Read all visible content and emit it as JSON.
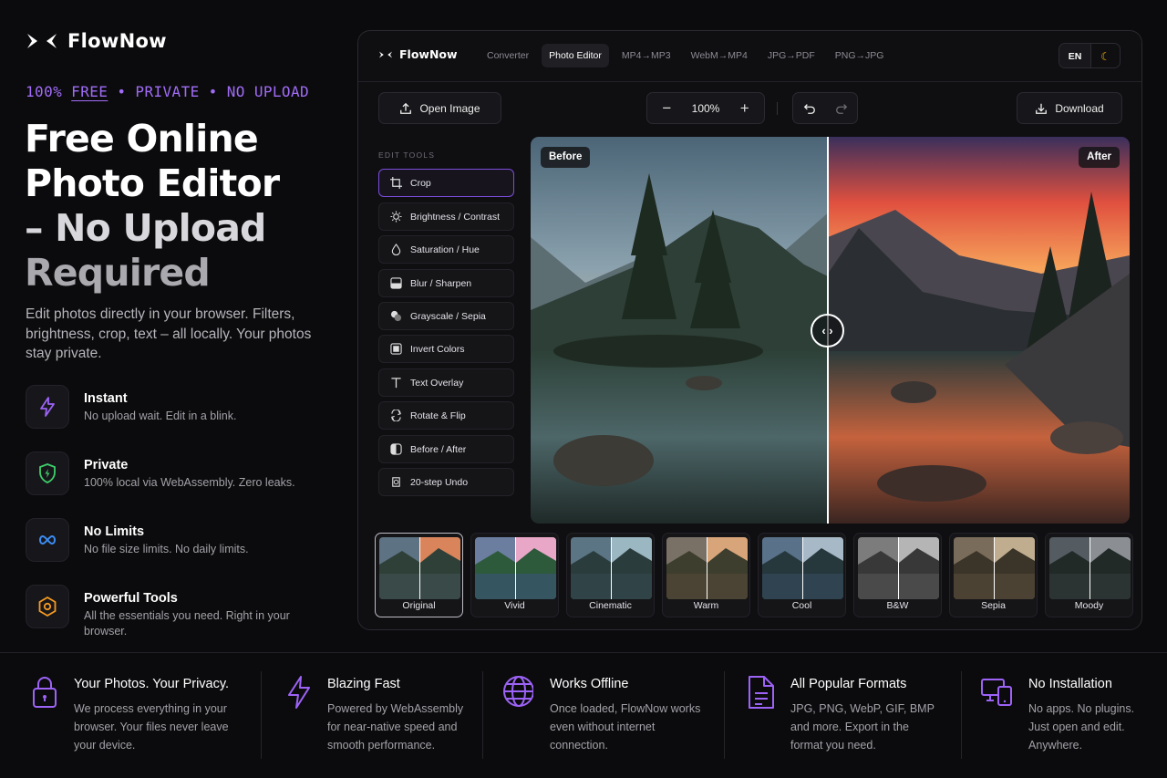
{
  "brand": {
    "name": "FlowNow"
  },
  "hero": {
    "tagline_prefix": "100% ",
    "tagline_free": "FREE",
    "tagline_rest": " • PRIVATE • NO UPLOAD",
    "title_lines": [
      "Free Online",
      "Photo Editor",
      "– No Upload",
      "Required"
    ],
    "description": "Edit photos directly in your browser. Filters, brightness, crop, text – all locally. Your photos stay private."
  },
  "features": [
    {
      "title": "Instant",
      "desc": "No upload wait. Edit in a blink.",
      "icon": "lightning-icon"
    },
    {
      "title": "Private",
      "desc": "100% local via WebAssembly. Zero leaks.",
      "icon": "shield-icon"
    },
    {
      "title": "No Limits",
      "desc": "No file size limits. No daily limits.",
      "icon": "infinity-icon"
    },
    {
      "title": "Powerful Tools",
      "desc": "All the essentials you need. Right in your browser.",
      "icon": "hexagon-icon"
    }
  ],
  "app": {
    "logo": "FlowNow",
    "tabs": [
      "Converter",
      "Photo Editor",
      "MP4→MP3",
      "WebM→MP4",
      "JPG→PDF",
      "PNG→JPG"
    ],
    "active_tab": "Photo Editor",
    "lang": "EN",
    "theme_icon": "☾",
    "open_label": "Open Image",
    "zoom_minus": "−",
    "zoom_value": "100%",
    "zoom_plus": "+",
    "download_label": "Download",
    "tools_label": "EDIT TOOLS",
    "tools": [
      "Crop",
      "Brightness / Contrast",
      "Saturation / Hue",
      "Blur / Sharpen",
      "Grayscale / Sepia",
      "Invert Colors",
      "Text Overlay",
      "Rotate & Flip",
      "Before / After",
      "20-step Undo"
    ],
    "active_tool": "Crop",
    "before_label": "Before",
    "after_label": "After",
    "handle_glyph": "‹ ›",
    "presets": [
      "Original",
      "Vivid",
      "Cinematic",
      "Warm",
      "Cool",
      "B&W",
      "Sepia",
      "Moody"
    ],
    "active_preset": "Original"
  },
  "strip": [
    {
      "title": "Your Photos. Your Privacy.",
      "desc": [
        "We process everything in your",
        "browser. Your files never leave",
        "your device."
      ],
      "icon": "lock-icon"
    },
    {
      "title": "Blazing Fast",
      "desc": [
        "Powered by WebAssembly",
        "for near-native speed and",
        "smooth performance."
      ],
      "icon": "lightning-icon"
    },
    {
      "title": "Works Offline",
      "desc": [
        "Once loaded, FlowNow works",
        "even without internet",
        "connection."
      ],
      "icon": "globe-icon"
    },
    {
      "title": "All Popular Formats",
      "desc": [
        "JPG, PNG, WebP, GIF, BMP",
        "and more. Export in the",
        "format you need."
      ],
      "icon": "document-icon"
    },
    {
      "title": "No Installation",
      "desc": [
        "No apps. No plugins.",
        "Just open and edit.",
        "Anywhere."
      ],
      "icon": "devices-icon"
    }
  ],
  "colors": {
    "accent": "#a06cf5",
    "background": "#0b0b0d",
    "panel": "#0f0f12"
  }
}
